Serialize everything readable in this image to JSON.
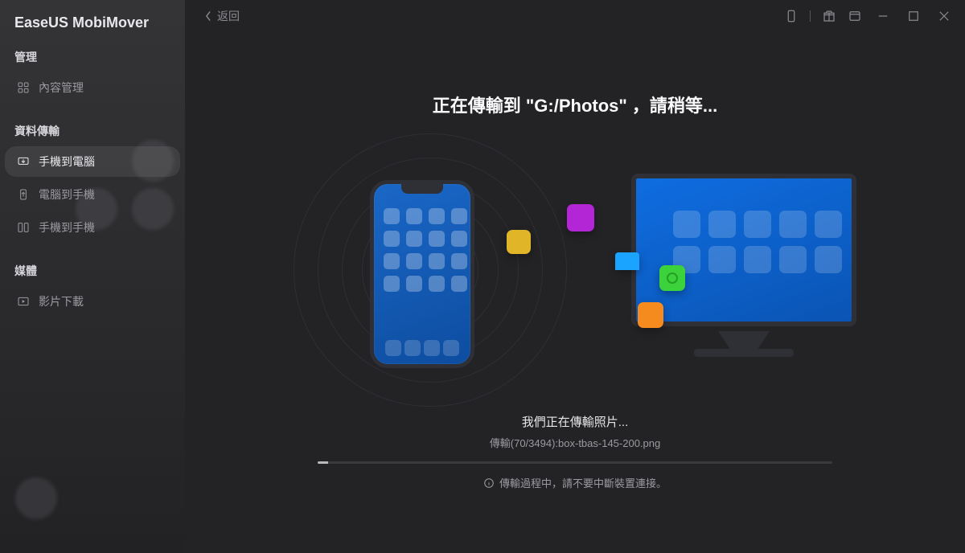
{
  "app": {
    "brand": "EaseUS MobiMover"
  },
  "sidebar": {
    "sections": {
      "manage": {
        "label": "管理"
      },
      "transfer": {
        "label": "資料傳輸"
      },
      "media": {
        "label": "媒體"
      }
    },
    "items": {
      "contentManage": "內容管理",
      "phoneToPc": "手機到電腦",
      "pcToPhone": "電腦到手機",
      "phoneToPhone": "手機到手機",
      "videoDownload": "影片下載"
    }
  },
  "titlebar": {
    "back": "返回"
  },
  "transfer": {
    "headline": "正在傳輸到 \"G:/Photos\" ，請稍等...",
    "statusTitle": "我們正在傳輸照片...",
    "statusDetail": "傳輸(70/3494):box-tbas-145-200.png",
    "warning": "傳輸過程中，請不要中斷裝置連接。",
    "progressPercent": 2
  }
}
